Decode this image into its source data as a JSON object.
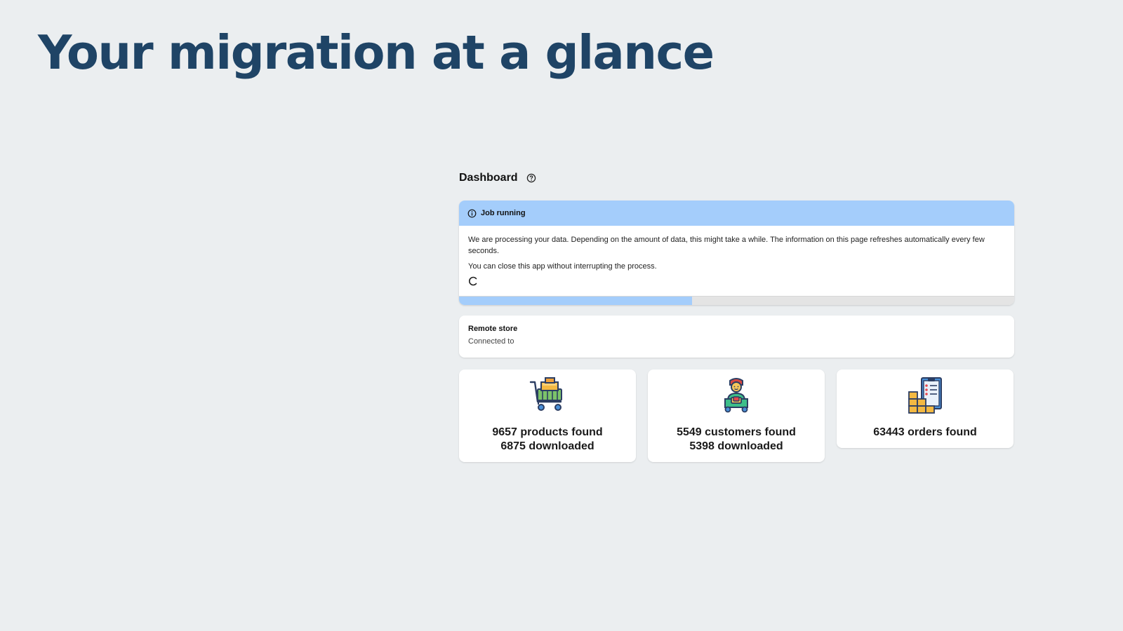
{
  "slide": {
    "title": "Your migration at a glance"
  },
  "dashboard": {
    "title": "Dashboard",
    "help_icon": "question-circle-icon"
  },
  "job_banner": {
    "status": "Job running",
    "status_icon": "info-circle-icon",
    "message_1": "We are processing your data. Depending on the amount of data, this might take a while. The information on this page refreshes automatically every few seconds.",
    "message_2": "You can close this app without interrupting the process.",
    "spinner_icon": "loading-spinner-icon",
    "progress_percent": 42,
    "accent_color": "#a4cdfb"
  },
  "remote_store": {
    "title": "Remote store",
    "status": "Connected to"
  },
  "stats": [
    {
      "icon": "shopping-cart-icon",
      "line1": "9657 products found",
      "line2": "6875 downloaded"
    },
    {
      "icon": "customer-icon",
      "line1": "5549 customers found",
      "line2": "5398 downloaded"
    },
    {
      "icon": "orders-clipboard-icon",
      "line1": "63443 orders found",
      "line2": ""
    }
  ]
}
